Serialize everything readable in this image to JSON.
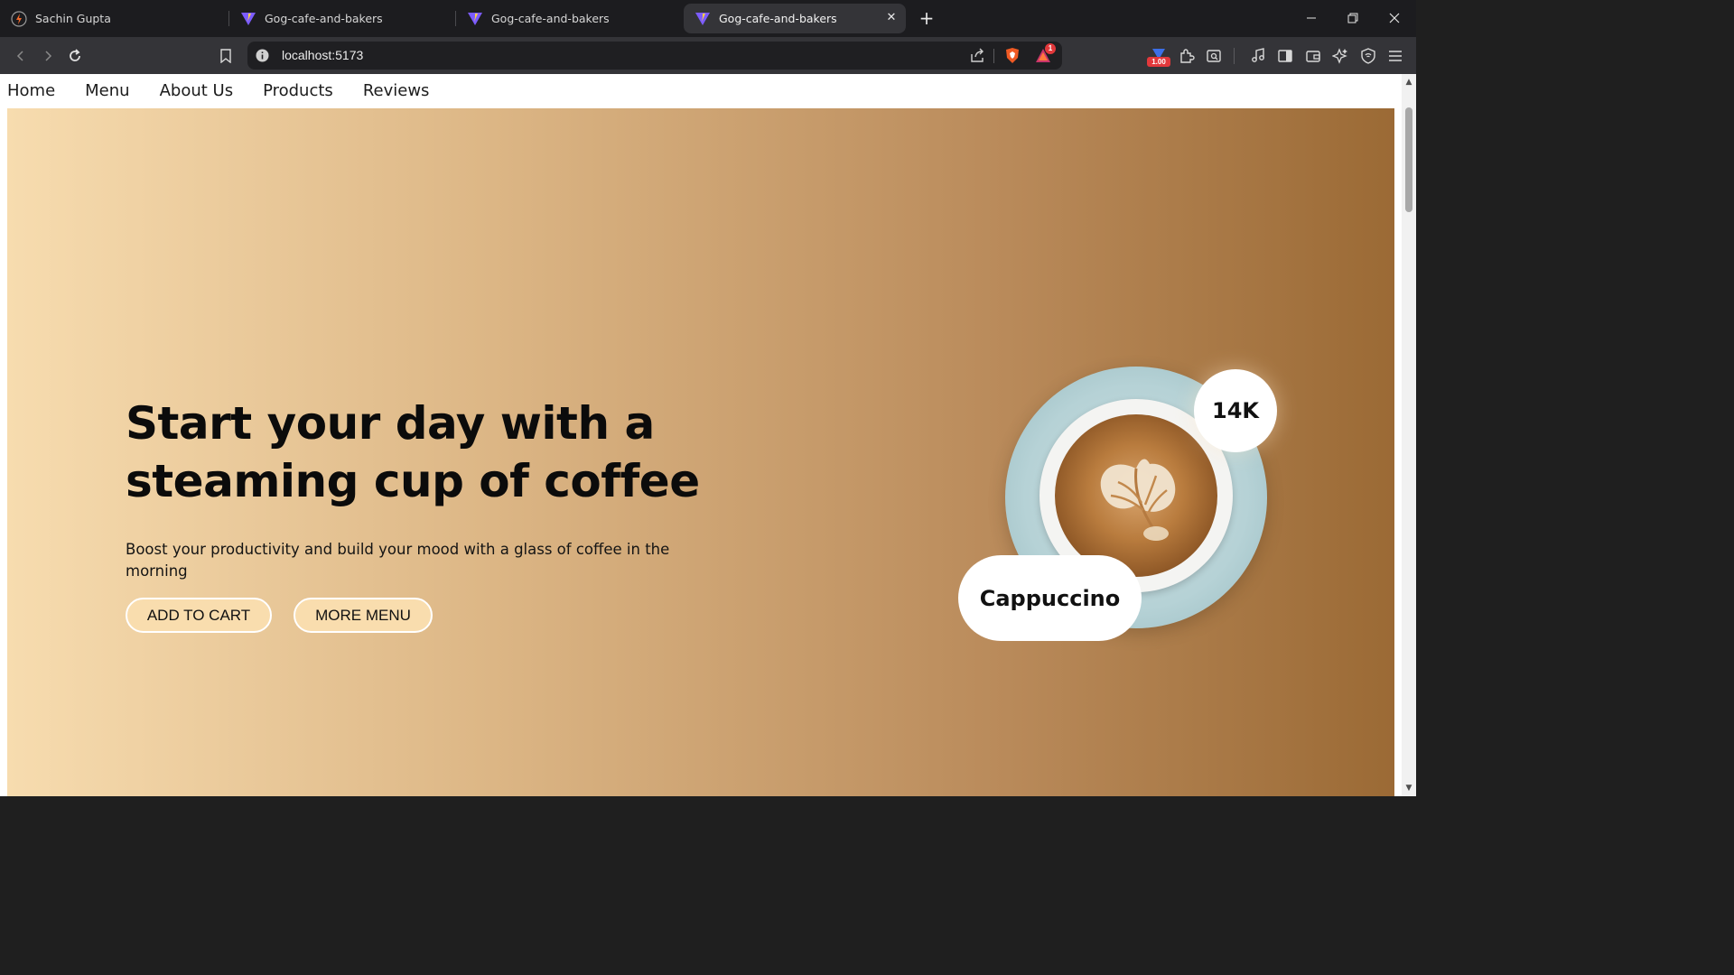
{
  "browser": {
    "tabs": [
      {
        "title": "Sachin Gupta",
        "icon": "bolt-icon"
      },
      {
        "title": "Gog-cafe-and-bakers",
        "icon": "vite-icon"
      },
      {
        "title": "Gog-cafe-and-bakers",
        "icon": "vite-icon"
      },
      {
        "title": "Gog-cafe-and-bakers",
        "icon": "vite-icon",
        "active": true
      }
    ],
    "url": "localhost:5173",
    "rewards_badge": "1",
    "wallet_badge": "1.00"
  },
  "page": {
    "nav": [
      "Home",
      "Menu",
      "About Us",
      "Products",
      "Reviews"
    ],
    "hero": {
      "headline_line1": "Start your day with a",
      "headline_line2": "steaming cup of coffee",
      "subtitle": "Boost your productivity and build your mood with a glass of coffee in the morning",
      "add_to_cart": "ADD TO CART",
      "more_menu": "MORE MENU",
      "stat": "14K",
      "product_name": "Cappuccino"
    }
  },
  "colors": {
    "gradient_start": "#f7dcaf",
    "gradient_end": "#9b6a35",
    "button_bg": "#f9ddae"
  }
}
